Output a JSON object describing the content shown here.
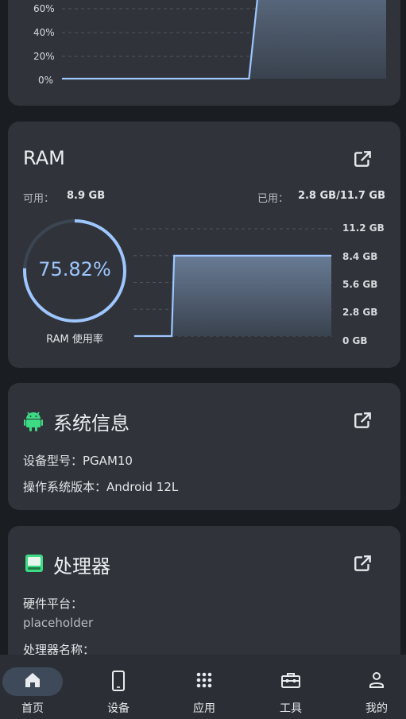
{
  "cpu_chart": {
    "ticks": [
      "60%",
      "40%",
      "20%",
      "0%"
    ],
    "values": [
      0,
      0,
      0,
      0,
      0,
      0,
      0,
      0,
      0,
      0,
      0,
      0,
      0,
      0,
      0,
      0,
      100,
      100,
      100,
      100,
      100,
      100,
      100,
      100,
      100,
      100,
      100
    ]
  },
  "ram": {
    "title": "RAM",
    "available_label": "可用：",
    "available_value": "8.9 GB",
    "used_label": "已用：",
    "used_value": "2.8 GB/11.7 GB",
    "gauge_percent": "75.82%",
    "gauge_fraction": 0.7582,
    "gauge_caption": "RAM 使用率",
    "chart_data": {
      "type": "area",
      "y_ticks": [
        "11.2 GB",
        "8.4 GB",
        "5.6 GB",
        "2.8 GB",
        "0 GB"
      ],
      "ylim": [
        0,
        11.2
      ],
      "values": [
        0,
        0,
        0,
        0,
        0,
        0,
        0,
        0,
        0,
        0,
        0,
        0,
        0,
        0,
        0,
        0,
        8.4,
        8.4,
        8.4,
        8.4,
        8.4,
        8.4,
        8.4,
        8.4,
        8.4,
        8.4,
        8.4,
        8.4,
        8.4,
        8.4,
        8.4,
        8.4,
        8.4,
        8.4,
        8.4,
        8.4,
        8.4,
        8.4,
        8.4,
        8.4,
        8.4,
        8.4,
        8.4,
        8.4,
        8.4,
        8.4,
        8.4,
        8.4,
        8.4,
        8.4,
        8.4,
        8.4,
        8.4,
        8.4,
        8.4,
        8.4,
        8.4,
        8.4,
        8.4,
        8.4,
        8.4,
        8.4,
        8.4,
        8.4,
        8.4,
        8.4,
        8.4,
        8.4,
        8.4,
        8.4,
        8.4,
        8.4,
        8.4,
        8.4,
        8.4,
        8.4,
        8.4,
        8.4,
        8.4,
        8.4
      ]
    }
  },
  "sysinfo": {
    "title": "系统信息",
    "model_label": "设备型号：",
    "model_value": "PGAM10",
    "os_label": "操作系统版本：",
    "os_value": "Android 12L"
  },
  "cpu": {
    "title": "处理器",
    "platform_label": "硬件平台：",
    "platform_value": "placeholder",
    "name_label": "处理器名称："
  },
  "nav": {
    "items": [
      {
        "label": "首页",
        "icon": "home-icon",
        "active": true
      },
      {
        "label": "设备",
        "icon": "phone-icon",
        "active": false
      },
      {
        "label": "应用",
        "icon": "apps-grid-icon",
        "active": false
      },
      {
        "label": "工具",
        "icon": "toolbox-icon",
        "active": false
      },
      {
        "label": "我的",
        "icon": "person-icon",
        "active": false
      }
    ]
  },
  "colors": {
    "accent": "#9ec6ff",
    "card": "#30343a",
    "background": "#1a1d21",
    "android_green": "#3ddc84"
  }
}
